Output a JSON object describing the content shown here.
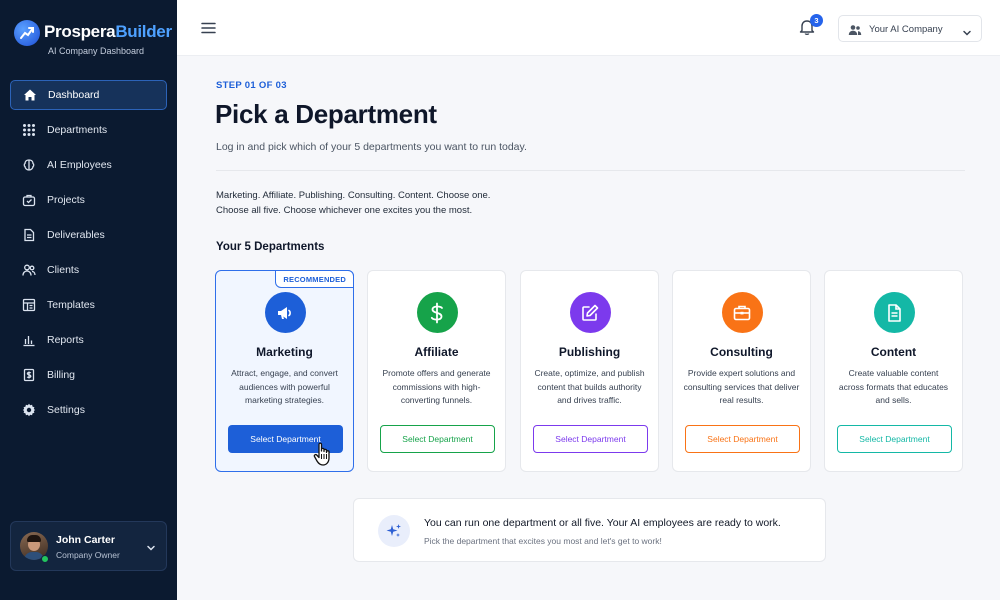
{
  "brand": {
    "name_part1": "Prospera",
    "name_part2": "Builder",
    "subtitle": "AI Company Dashboard"
  },
  "sidebar": {
    "items": [
      {
        "label": "Dashboard",
        "icon": "home-icon",
        "active": true
      },
      {
        "label": "Departments",
        "icon": "grid-icon",
        "active": false
      },
      {
        "label": "AI Employees",
        "icon": "ai-brain-icon",
        "active": false
      },
      {
        "label": "Projects",
        "icon": "projects-icon",
        "active": false
      },
      {
        "label": "Deliverables",
        "icon": "document-icon",
        "active": false
      },
      {
        "label": "Clients",
        "icon": "users-icon",
        "active": false
      },
      {
        "label": "Templates",
        "icon": "template-icon",
        "active": false
      },
      {
        "label": "Reports",
        "icon": "chart-icon",
        "active": false
      },
      {
        "label": "Billing",
        "icon": "billing-icon",
        "active": false
      },
      {
        "label": "Settings",
        "icon": "gear-icon",
        "active": false
      }
    ],
    "user": {
      "name": "John Carter",
      "role": "Company Owner"
    }
  },
  "topbar": {
    "notification_count": "3",
    "company": "Your AI Company"
  },
  "main": {
    "step": "STEP 01 OF 03",
    "title": "Pick a Department",
    "subtitle": "Log in and pick which of your 5 departments you want to run today.",
    "desc_line1": "Marketing. Affiliate. Publishing. Consulting. Content. Choose one.",
    "desc_line2": "Choose all five. Choose whichever one excites you the most.",
    "section_title": "Your 5 Departments",
    "recommended_label": "RECOMMENDED",
    "departments": [
      {
        "name": "Marketing",
        "desc": "Attract, engage, and convert audiences with powerful marketing strategies.",
        "button": "Select Department",
        "icon": "megaphone-icon",
        "color": "#1d5fd8"
      },
      {
        "name": "Affiliate",
        "desc": "Promote offers and generate commissions with high-converting funnels.",
        "button": "Select Department",
        "icon": "dollar-icon",
        "color": "#16a34a"
      },
      {
        "name": "Publishing",
        "desc": "Create, optimize, and publish content that builds authority and drives traffic.",
        "button": "Select Department",
        "icon": "edit-icon",
        "color": "#7c3aed"
      },
      {
        "name": "Consulting",
        "desc": "Provide expert solutions and consulting services that deliver real results.",
        "button": "Select Department",
        "icon": "briefcase-icon",
        "color": "#f97316"
      },
      {
        "name": "Content",
        "desc": "Create valuable content across formats that educates and sells.",
        "button": "Select Department",
        "icon": "file-icon",
        "color": "#14b8a6"
      }
    ],
    "banner": {
      "title": "You can run one department or all five. Your AI employees are ready to work.",
      "subtitle": "Pick the department that excites you most and let's get to work!"
    }
  },
  "colors": {
    "sidebar_bg": "#0b1a30",
    "accent": "#1d5fd8",
    "page_bg": "#f6f7fa"
  }
}
